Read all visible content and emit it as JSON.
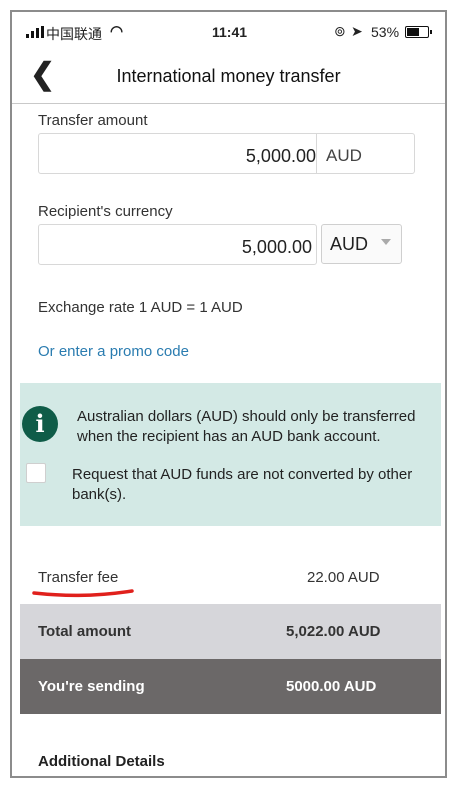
{
  "status_bar": {
    "carrier": "中国联通",
    "time": "11:41",
    "battery": "53%",
    "battery_level": 0.53
  },
  "header": {
    "title": "International money transfer"
  },
  "transfer": {
    "amount_label": "Transfer amount",
    "amount_value": "5,000.00",
    "amount_currency": "AUD",
    "recipient_label": "Recipient's currency",
    "recipient_value": "5,000.00",
    "recipient_currency": "AUD",
    "exchange_rate": "Exchange rate 1 AUD = 1 AUD",
    "promo_link": "Or enter a promo code"
  },
  "notice": {
    "message": "Australian dollars (AUD) should only be transferred when the recipient has an AUD bank account.",
    "checkbox_label": "Request that AUD funds are not converted by other bank(s).",
    "checkbox_checked": false,
    "background_color": "#d3e9e5",
    "icon_color": "#0f5c48"
  },
  "summary": {
    "fee_label": "Transfer fee",
    "fee_value": "22.00 AUD",
    "total_label": "Total amount",
    "total_value": "5,022.00 AUD",
    "sending_label": "You're sending",
    "sending_value": "5000.00 AUD",
    "annotation_color": "#e0201c"
  },
  "footer": {
    "section_title": "Additional Details"
  }
}
